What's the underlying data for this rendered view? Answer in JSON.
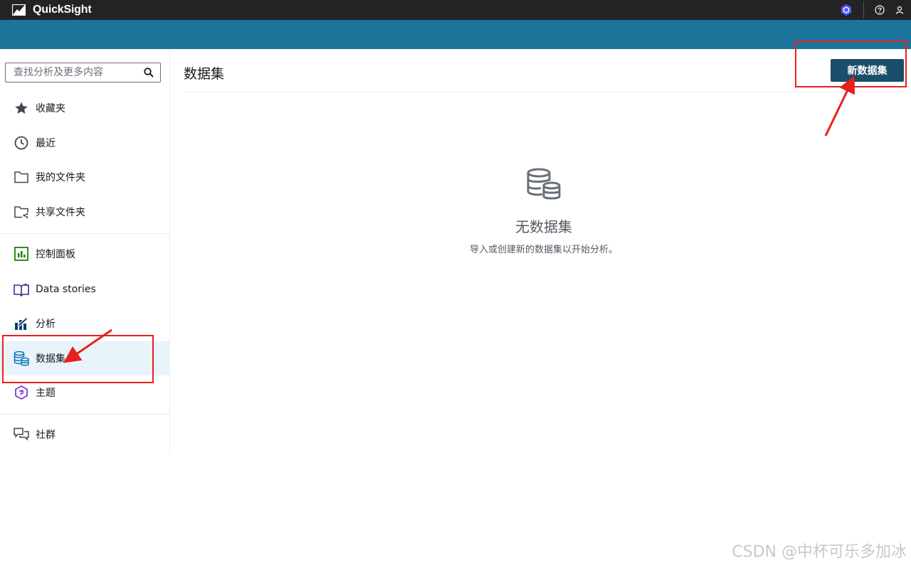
{
  "app": {
    "title": "QuickSight"
  },
  "search": {
    "placeholder": "查找分析及更多内容"
  },
  "sidebar": {
    "items": [
      {
        "label": "收藏夹",
        "icon": "star-icon"
      },
      {
        "label": "最近",
        "icon": "clock-icon"
      },
      {
        "label": "我的文件夹",
        "icon": "folder-icon"
      },
      {
        "label": "共享文件夹",
        "icon": "shared-folder-icon"
      },
      {
        "label": "控制面板",
        "icon": "dashboard-icon"
      },
      {
        "label": "Data stories",
        "icon": "data-stories-icon"
      },
      {
        "label": "分析",
        "icon": "analysis-icon"
      },
      {
        "label": "数据集",
        "icon": "dataset-icon",
        "active": true
      },
      {
        "label": "主题",
        "icon": "theme-icon"
      },
      {
        "label": "社群",
        "icon": "community-icon"
      }
    ]
  },
  "main": {
    "title": "数据集",
    "new_button": "新数据集",
    "empty_title": "无数据集",
    "empty_description": "导入或创建新的数据集以开始分析。"
  },
  "watermark": "CSDN @中杯可乐多加冰",
  "colors": {
    "topbar": "#232323",
    "bluebar": "#1b7499",
    "primary_button": "#1a4e6b",
    "active_nav": "#e8f4fa",
    "annotation": "#e8201c"
  }
}
